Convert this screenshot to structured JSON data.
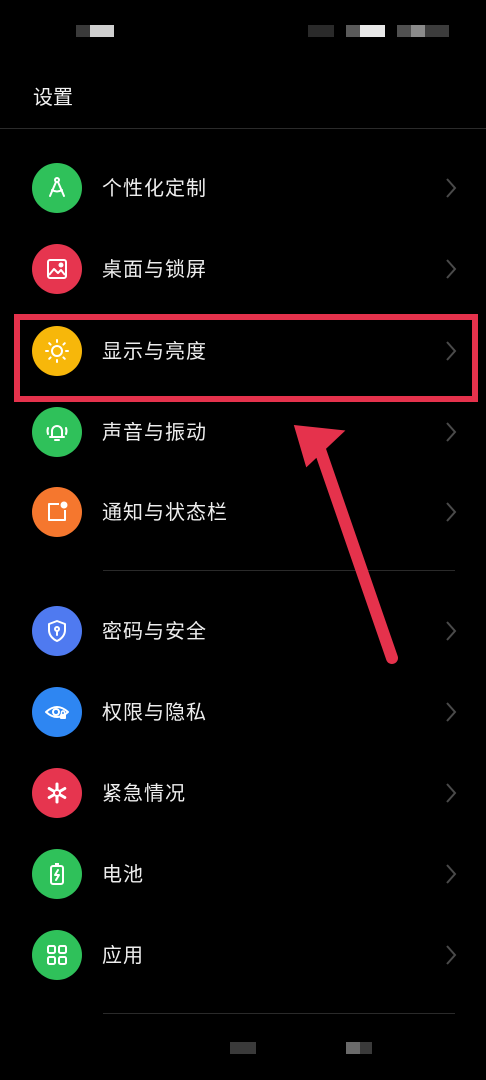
{
  "page": {
    "title": "设置"
  },
  "colors": {
    "background": "#000000",
    "highlight": "#e5324c",
    "chevron": "#4a4a4a"
  },
  "menu": {
    "items": [
      {
        "label": "个性化定制",
        "icon": "compass-icon",
        "color": "#2fc15a"
      },
      {
        "label": "桌面与锁屏",
        "icon": "picture-icon",
        "color": "#e6354f"
      },
      {
        "label": "显示与亮度",
        "icon": "sun-icon",
        "color": "#f7b70a"
      },
      {
        "label": "声音与振动",
        "icon": "bell-icon",
        "color": "#2fc15a"
      },
      {
        "label": "通知与状态栏",
        "icon": "notification-icon",
        "color": "#f5772e"
      },
      {
        "label": "密码与安全",
        "icon": "shield-icon",
        "color": "#4f7af0"
      },
      {
        "label": "权限与隐私",
        "icon": "eye-lock-icon",
        "color": "#2e86f2"
      },
      {
        "label": "紧急情况",
        "icon": "asterisk-icon",
        "color": "#e6354f"
      },
      {
        "label": "电池",
        "icon": "battery-icon",
        "color": "#2fc15a"
      },
      {
        "label": "应用",
        "icon": "grid-icon",
        "color": "#2fc15a"
      }
    ]
  }
}
